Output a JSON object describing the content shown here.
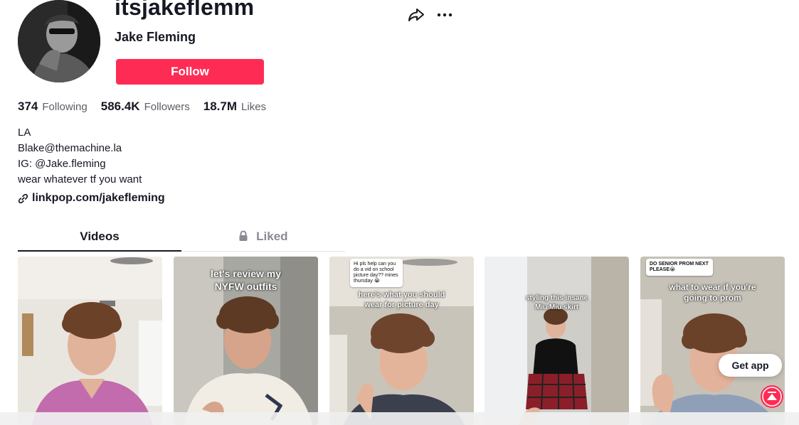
{
  "profile": {
    "username": "itsjakeflemm",
    "display_name": "Jake Fleming",
    "follow_label": "Follow",
    "avatar_icon": "profile-avatar",
    "share_icon": "share-icon",
    "more_icon": "more-icon"
  },
  "stats": {
    "following_count": "374",
    "following_label": "Following",
    "followers_count": "586.4K",
    "followers_label": "Followers",
    "likes_count": "18.7M",
    "likes_label": "Likes"
  },
  "bio": {
    "lines": [
      "LA",
      "Blake@themachine.la",
      "IG: @Jake.fleming",
      "wear whatever tf you want"
    ],
    "link": "linkpop.com/jakefleming",
    "link_icon": "link-icon"
  },
  "tabs": {
    "videos": "Videos",
    "liked": "Liked",
    "liked_icon": "lock-icon"
  },
  "videos": [
    {
      "caption": "",
      "reply": ""
    },
    {
      "caption": "let's review my NYFW outfits",
      "reply": ""
    },
    {
      "caption": "here's what you should wear for picture day",
      "reply": "Hi pls help can you do a vid on school picture day?? mines thursday 😭"
    },
    {
      "caption": "styling this insane Miu Miu skirt",
      "reply": ""
    },
    {
      "caption": "what to wear if you're going to prom",
      "reply": "DO SENIOR PROM NEXT PLEASE😭"
    }
  ],
  "floating": {
    "get_app": "Get app",
    "back_to_top_icon": "back-to-top-icon"
  },
  "colors": {
    "accent": "#fe2c55",
    "text": "#161823",
    "muted": "#5c5d66"
  }
}
